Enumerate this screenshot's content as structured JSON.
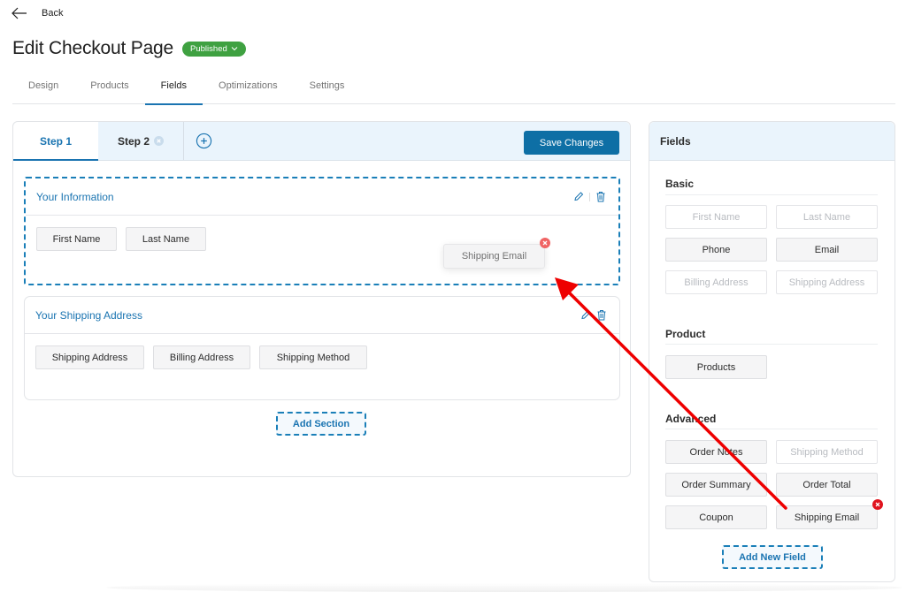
{
  "nav": {
    "back_label": "Back"
  },
  "header": {
    "title": "Edit Checkout Page",
    "status": "Published"
  },
  "tabs": [
    {
      "label": "Design",
      "active": false
    },
    {
      "label": "Products",
      "active": false
    },
    {
      "label": "Fields",
      "active": true
    },
    {
      "label": "Optimizations",
      "active": false
    },
    {
      "label": "Settings",
      "active": false
    }
  ],
  "steps": {
    "items": [
      {
        "label": "Step 1",
        "active": true
      },
      {
        "label": "Step 2",
        "active": false
      }
    ],
    "save_label": "Save Changes"
  },
  "sections": [
    {
      "title": "Your Information",
      "fields": [
        "First Name",
        "Last Name"
      ],
      "drop_target": true
    },
    {
      "title": "Your Shipping Address",
      "fields": [
        "Shipping Address",
        "Billing Address",
        "Shipping Method"
      ],
      "drop_target": false
    }
  ],
  "dragging": {
    "label": "Shipping Email"
  },
  "add_section_label": "Add Section",
  "fields_panel": {
    "title": "Fields",
    "groups": [
      {
        "title": "Basic",
        "fields": [
          {
            "label": "First Name",
            "enabled": false
          },
          {
            "label": "Last Name",
            "enabled": false
          },
          {
            "label": "Phone",
            "enabled": true
          },
          {
            "label": "Email",
            "enabled": true
          },
          {
            "label": "Billing Address",
            "enabled": false
          },
          {
            "label": "Shipping Address",
            "enabled": false
          }
        ]
      },
      {
        "title": "Product",
        "fields": [
          {
            "label": "Products",
            "enabled": true
          }
        ]
      },
      {
        "title": "Advanced",
        "fields": [
          {
            "label": "Order Notes",
            "enabled": true
          },
          {
            "label": "Shipping Method",
            "enabled": false
          },
          {
            "label": "Order Summary",
            "enabled": true
          },
          {
            "label": "Order Total",
            "enabled": true
          },
          {
            "label": "Coupon",
            "enabled": true
          },
          {
            "label": "Shipping Email",
            "enabled": true
          }
        ]
      }
    ],
    "add_field_label": "Add New Field"
  },
  "colors": {
    "accent": "#1a74b1",
    "published": "#3fa141",
    "remove": "#e0141e",
    "annotation_arrow": "#ee0000"
  }
}
